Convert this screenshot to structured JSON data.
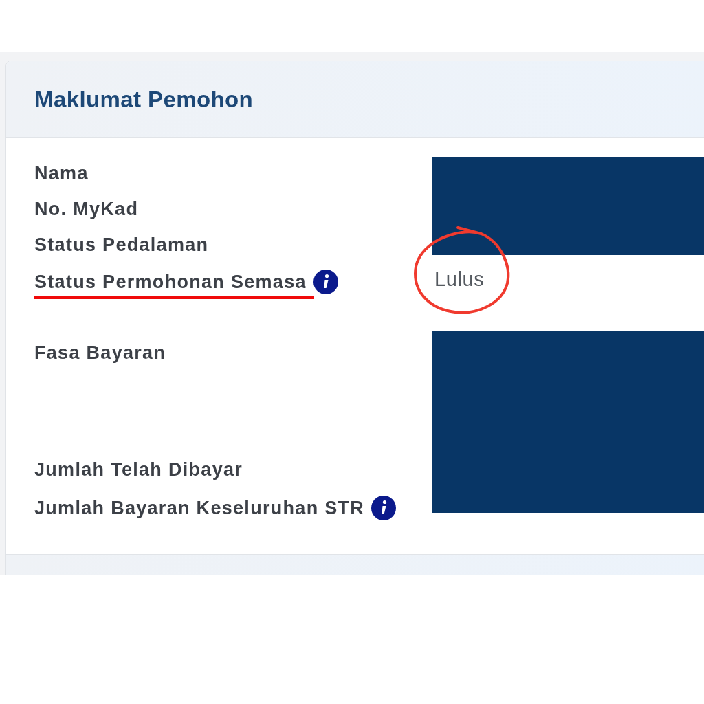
{
  "panel": {
    "title": "Maklumat Pemohon"
  },
  "sections": [
    {
      "labels": [
        {
          "text": "Nama",
          "info": false,
          "underlined": false
        },
        {
          "text": "No. MyKad",
          "info": false,
          "underlined": false
        },
        {
          "text": "Status Pedalaman",
          "info": false,
          "underlined": false
        }
      ],
      "value": {
        "kind": "redacted",
        "circled": false
      }
    },
    {
      "labels": [
        {
          "text": "Status Permohonan Semasa",
          "info": true,
          "underlined": true
        }
      ],
      "value": {
        "kind": "text",
        "text": "Lulus",
        "circled": true
      }
    },
    {
      "labels": [
        {
          "text": "Fasa Bayaran",
          "info": false,
          "underlined": false
        },
        {
          "text": "Jumlah Telah Dibayar",
          "info": false,
          "underlined": false
        },
        {
          "text": "Jumlah Bayaran Keseluruhan STR",
          "info": true,
          "underlined": false
        }
      ],
      "value": {
        "kind": "redacted",
        "circled": false
      }
    }
  ]
}
